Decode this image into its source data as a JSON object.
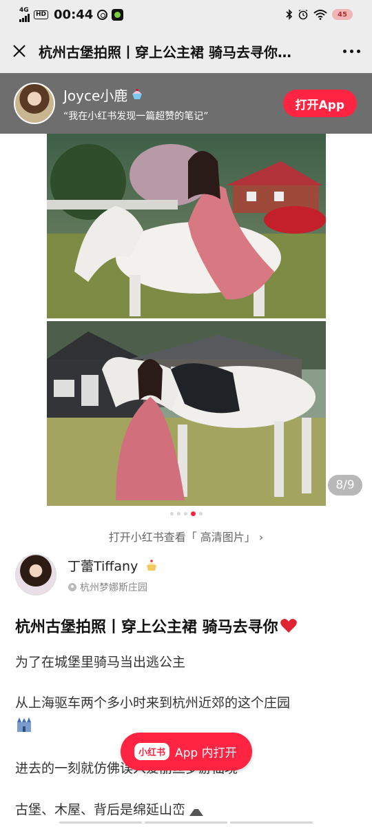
{
  "status": {
    "network": "4G",
    "hd": "HD",
    "time": "00:44",
    "battery": "45"
  },
  "header": {
    "title": "杭州古堡拍照丨穿上公主裙 骑马去寻你…"
  },
  "banner": {
    "name": "Joyce小鹿",
    "subtitle": "“我在小红书发现一篇超赞的笔记”",
    "open_app": "打开App"
  },
  "gallery": {
    "counter": "8/9",
    "hd_link": "打开小红书查看「 高清图片」 ›",
    "dots_total": 5,
    "dots_active": 3
  },
  "author": {
    "name": "丁蕾Tiffany",
    "location": "杭州梦娜斯庄园"
  },
  "post": {
    "title": "杭州古堡拍照丨穿上公主裙 骑马去寻你",
    "p1": "为了在城堡里骑马当出逃公主",
    "p2": "从上海驱车两个多小时来到杭州近郊的这个庄园",
    "p3": "进去的一刻就仿佛误入爱丽丝梦游仙境",
    "p4": "古堡、木屋、背后是绵延山峦"
  },
  "float_button": {
    "logo": "小红书",
    "label": "App 内打开"
  },
  "colors": {
    "accent": "#ff2442",
    "banner_bg": "#6e6e6e",
    "bar_bg": "#ededed"
  }
}
